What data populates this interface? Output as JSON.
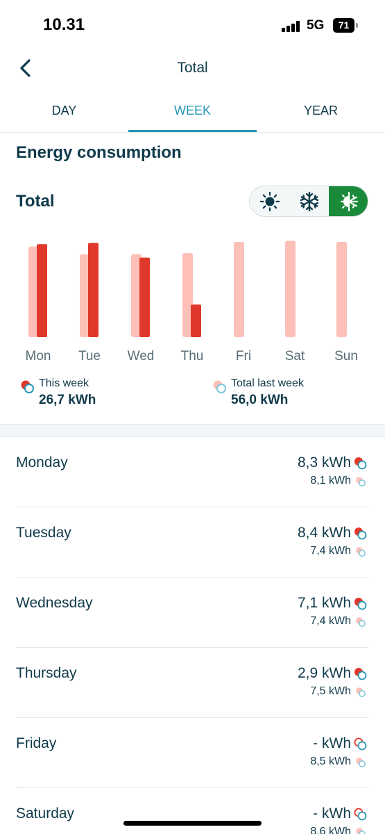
{
  "status": {
    "time": "10.31",
    "network": "5G",
    "battery": "71"
  },
  "header": {
    "title": "Total"
  },
  "tabs": [
    {
      "label": "DAY"
    },
    {
      "label": "WEEK"
    },
    {
      "label": "YEAR"
    }
  ],
  "section_title": "Energy consumption",
  "chart_title": "Total",
  "mode_toggle": {
    "options": [
      "sun-icon",
      "snowflake-icon",
      "sun-snowflake-icon"
    ],
    "selected": "sun-snowflake-icon"
  },
  "chart_data": {
    "type": "bar",
    "categories": [
      "Mon",
      "Tue",
      "Wed",
      "Thu",
      "Fri",
      "Sat",
      "Sun"
    ],
    "series": [
      {
        "name": "Total last week",
        "values": [
          8.1,
          7.4,
          7.4,
          7.5,
          8.5,
          8.6,
          8.5
        ],
        "color": "#fcc0b8"
      },
      {
        "name": "This week",
        "values": [
          8.3,
          8.4,
          7.1,
          2.9,
          null,
          null,
          null
        ],
        "color": "#e0382b"
      }
    ]
  },
  "legend": {
    "this_week": {
      "label": "This week",
      "value": "26,7 kWh"
    },
    "last_week": {
      "label": "Total last week",
      "value": "56,0 kWh"
    }
  },
  "days": [
    {
      "name": "Monday",
      "current": "8,3 kWh",
      "last": "8,1 kWh",
      "filled": true
    },
    {
      "name": "Tuesday",
      "current": "8,4 kWh",
      "last": "7,4 kWh",
      "filled": true
    },
    {
      "name": "Wednesday",
      "current": "7,1 kWh",
      "last": "7,4 kWh",
      "filled": true
    },
    {
      "name": "Thursday",
      "current": "2,9 kWh",
      "last": "7,5 kWh",
      "filled": true
    },
    {
      "name": "Friday",
      "current": "- kWh",
      "last": "8,5 kWh",
      "filled": false
    },
    {
      "name": "Saturday",
      "current": "- kWh",
      "last": "8,6 kWh",
      "filled": false
    }
  ],
  "colors": {
    "accent": "#2596b4",
    "this_week": "#e0382b",
    "last_week": "#fcc0b8",
    "toggle_active": "#1a8a3a",
    "text": "#0f3a4a"
  }
}
